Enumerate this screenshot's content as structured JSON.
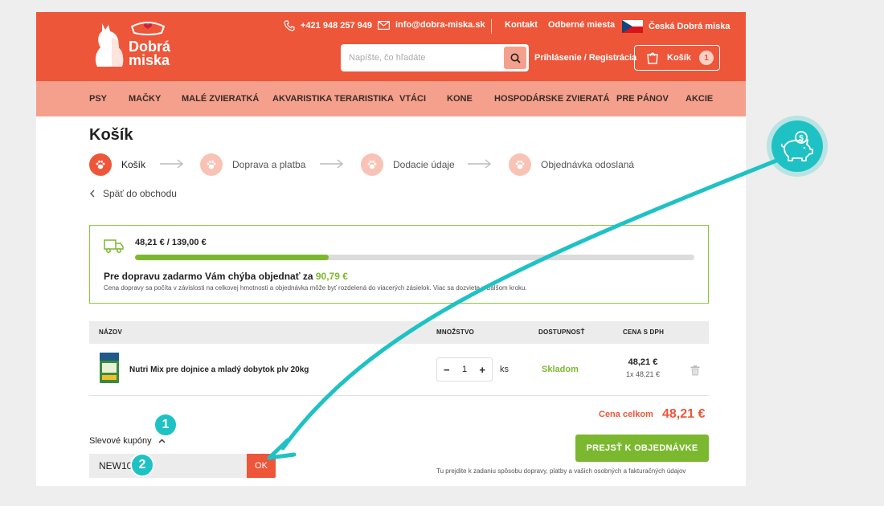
{
  "header": {
    "logo_line1": "Dobrá",
    "logo_line2": "miska",
    "phone": "+421 948 257 949",
    "email": "info@dobra-miska.sk",
    "links": [
      "Kontakt",
      "Odberné miesta"
    ],
    "country": "Česká Dobrá miska",
    "search_placeholder": "Napíšte, čo hľadáte",
    "login": "Prihlásenie / Registrácia",
    "cart_label": "Košík",
    "cart_count": "1",
    "brand_color": "#ee5639"
  },
  "nav": [
    "PSY",
    "MAČKY",
    "MALÉ ZVIERATKÁ",
    "AKVARISTIKA TERARISTIKA",
    "VTÁCI",
    "KONE",
    "HOSPODÁRSKE ZVIERATÁ",
    "PRE PÁNOV",
    "AKCIE"
  ],
  "page_title": "Košík",
  "steps": [
    "Košík",
    "Doprava a platba",
    "Dodacie údaje",
    "Objednávka odoslaná"
  ],
  "back_link": "Späť do obchodu",
  "shipping": {
    "amount": "48,21 € / 139,00 €",
    "progress": 0.3468,
    "message": "Pre dopravu zadarmo Vám chýba objednať za",
    "missing": "90,79 €",
    "note": "Cena dopravy sa počíta v závislosti na celkovej hmotnosti a objednávka môže byť rozdelená do viacerých zásielok. Viac sa dozviete v ďalšom kroku."
  },
  "table": {
    "headers": [
      "NÁZOV",
      "MNOŽSTVO",
      "DOSTUPNOSŤ",
      "CENA S DPH"
    ],
    "item": {
      "name": "Nutri Mix pre dojnice a mladý dobytok plv 20kg",
      "qty": "1",
      "unit": "ks",
      "availability": "Skladom",
      "price": "48,21 €",
      "unit_price": "1x 48,21 €"
    }
  },
  "total": {
    "label": "Cena celkom",
    "value": "48,21 €"
  },
  "coupon": {
    "toggle": "Slevové kupóny",
    "value": "NEW10",
    "ok": "OK"
  },
  "order": {
    "button": "PREJSŤ K OBJEDNÁVKE",
    "note": "Tu prejdite k zadaniu spôsobu dopravy, platby a vašich osobných a fakturačných údajov"
  },
  "badges": [
    "1",
    "2"
  ],
  "accent_teal": "#1fc2c4",
  "accent_green": "#7cb82f"
}
